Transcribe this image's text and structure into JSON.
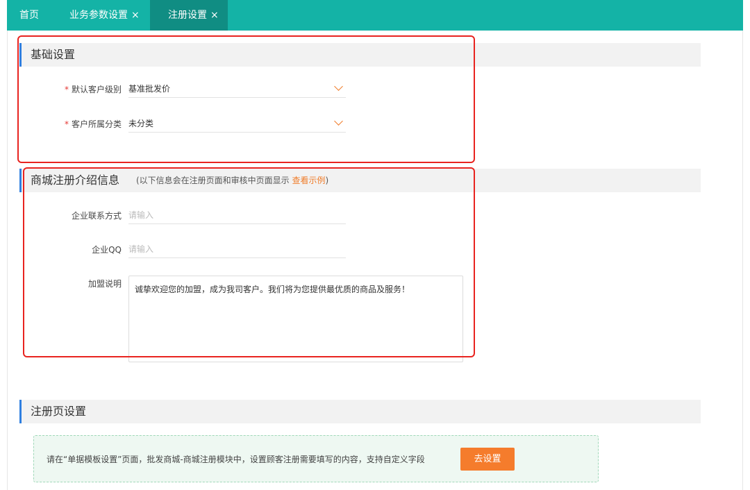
{
  "tabs": [
    {
      "label": "首页",
      "closable": false,
      "active": false
    },
    {
      "label": "业务参数设置",
      "closable": true,
      "active": false
    },
    {
      "label": "注册设置",
      "closable": true,
      "active": true
    }
  ],
  "tab_close_glyph": "×",
  "basic": {
    "title": "基础设置",
    "required_mark": "*",
    "level_label": "默认客户级别",
    "level_value": "基准批发价",
    "category_label": "客户所属分类",
    "category_value": "未分类"
  },
  "intro": {
    "title": "商城注册介绍信息",
    "hint_prefix": "(以下信息会在注册页面和审核中页面显示 ",
    "hint_link": "查看示例",
    "hint_suffix": ")",
    "contact_label": "企业联系方式",
    "contact_placeholder": "请输入",
    "qq_label": "企业QQ",
    "qq_placeholder": "请输入",
    "join_label": "加盟说明",
    "join_text": "诚挚欢迎您的加盟，成为我司客户。我们将为您提供最优质的商品及服务！"
  },
  "register_page": {
    "title": "注册页设置",
    "notice": "请在“单据模板设置”页面，批发商城-商城注册模块中，设置顾客注册需要填写的内容，支持自定义字段",
    "button": "去设置"
  },
  "colors": {
    "tabbar": "#14b3a6",
    "active_tab": "#108d83",
    "accent": "#f07d2b",
    "section_marker": "#2f7fe0",
    "annotation": "#e8231f"
  },
  "icons": {
    "dropdown": "chevron-down-icon",
    "close": "close-icon"
  }
}
